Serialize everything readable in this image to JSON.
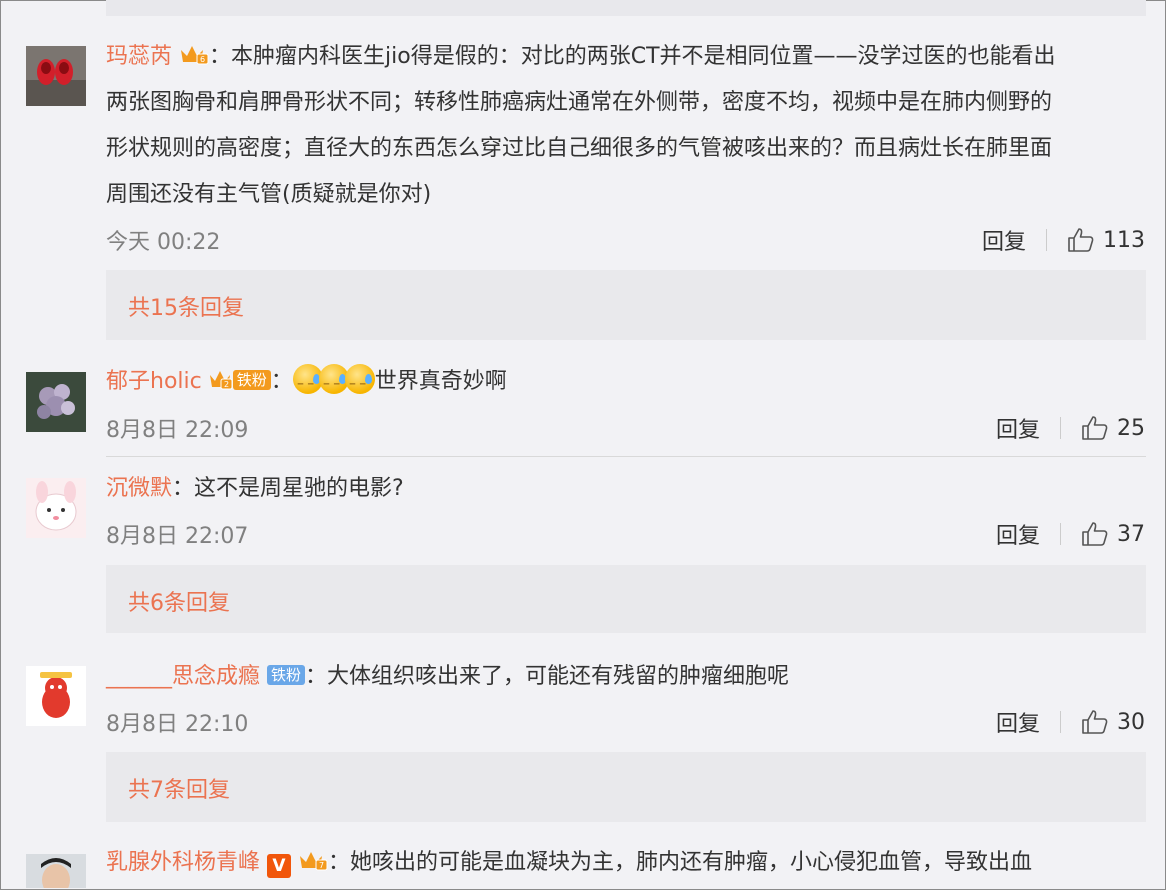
{
  "comments": [
    {
      "name": "玛蕊芮",
      "text_lines": [
        "本肿瘤内科医生jio得是假的：对比的两张CT并不是相同位置——没学过医的也能看出",
        "两张图胸骨和肩胛骨形状不同；转移性肺癌病灶通常在外侧带，密度不均，视频中是在肺内侧野的",
        "形状规则的高密度；直径大的东西怎么穿过比自己细很多的气管被咳出来的？而且病灶长在肺里面",
        "周围还没有主气管(质疑就是你对)"
      ],
      "time": "今天 00:22",
      "reply_label": "回复",
      "likes": "113",
      "replies_summary": "共15条回复"
    },
    {
      "name": "郁子holic",
      "badge": "铁粉",
      "text": "世界真奇妙啊",
      "time": "8月8日 22:09",
      "reply_label": "回复",
      "likes": "25"
    },
    {
      "name": "沉微默",
      "text": "这不是周星驰的电影?",
      "time": "8月8日 22:07",
      "reply_label": "回复",
      "likes": "37",
      "replies_summary": "共6条回复"
    },
    {
      "name": "______思念成瘾",
      "badge": "铁粉",
      "text": "大体组织咳出来了，可能还有残留的肿瘤细胞呢",
      "time": "8月8日 22:10",
      "reply_label": "回复",
      "likes": "30",
      "replies_summary": "共7条回复"
    },
    {
      "name": "乳腺外科杨青峰",
      "verified_letter": "V",
      "text": "她咳出的可能是血凝块为主，肺内还有肿瘤，小心侵犯血管，导致出血"
    }
  ],
  "colors": {
    "name": "#eb7350",
    "badge_orange": "#f39a1e",
    "badge_blue": "#6aa7e8",
    "background": "#f2f2f5",
    "reply_box": "#e9e9ec"
  },
  "icons": [
    "crown-badge-icon",
    "thumbs-up-icon",
    "crying-emoji-icon",
    "verified-v-icon"
  ]
}
